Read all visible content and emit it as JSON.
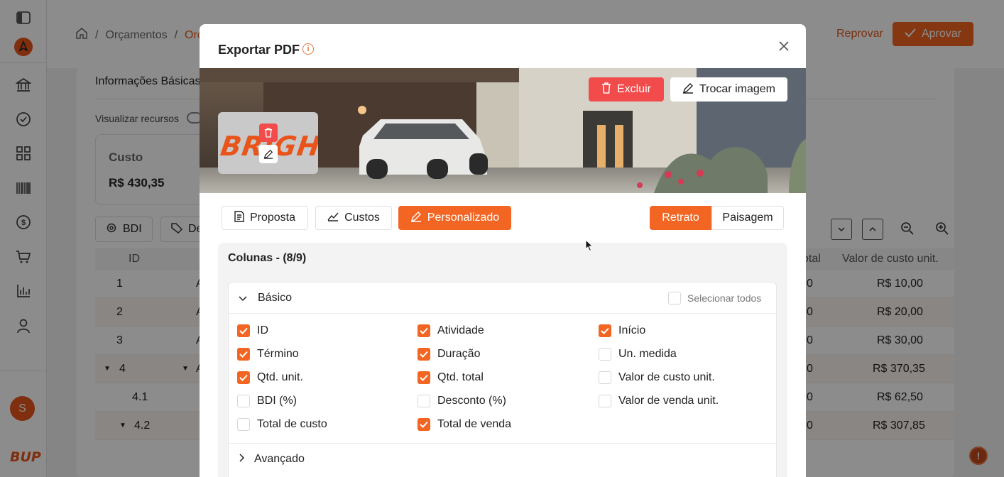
{
  "breadcrumb": {
    "items": [
      "Orçamentos",
      "Orça"
    ]
  },
  "header": {
    "reprovar_label": "Reprovar",
    "aprovar_label": "Aprovar"
  },
  "background": {
    "section_title": "Informações Básicas",
    "toggle_label": "Visualizar recursos",
    "card": {
      "label": "Custo",
      "value": "R$ 430,35"
    },
    "toolbar": {
      "bdi_label": "BDI",
      "desconto_label": "De"
    },
    "table": {
      "headers": {
        "id": "ID",
        "total": "otal",
        "unit_cost": "Valor de custo unit."
      },
      "rows": [
        {
          "id": "1",
          "act": "A",
          "total": "0",
          "unit": "R$ 10,00"
        },
        {
          "id": "2",
          "act": "A",
          "total": "0",
          "unit": "R$ 20,00"
        },
        {
          "id": "3",
          "act": "A",
          "total": "0",
          "unit": "R$ 30,00"
        },
        {
          "id": "4",
          "act": "A",
          "total": "0",
          "unit": "R$ 370,35"
        },
        {
          "id": "4.1",
          "act": "",
          "total": "0",
          "unit": "R$ 62,50"
        },
        {
          "id": "4.2",
          "act": "",
          "total": "0",
          "unit": "R$ 307,85"
        }
      ]
    }
  },
  "user": {
    "avatar_initial": "S"
  },
  "brand": {
    "short_logo": "BUP",
    "logo_text": "BRIGHUP"
  },
  "modal": {
    "title": "Exportar PDF",
    "banner": {
      "excluir_label": "Excluir",
      "trocar_label": "Trocar imagem"
    },
    "tabs": {
      "proposta": "Proposta",
      "custos": "Custos",
      "personalizado": "Personalizado"
    },
    "orientation": {
      "retrato": "Retrato",
      "paisagem": "Paisagem"
    },
    "columns_title": "Colunas - (8/9)",
    "basic_title": "Básico",
    "select_all_label": "Selecionar todos",
    "options": [
      {
        "label": "ID",
        "checked": true
      },
      {
        "label": "Atividade",
        "checked": true
      },
      {
        "label": "Início",
        "checked": true
      },
      {
        "label": "Término",
        "checked": true
      },
      {
        "label": "Duração",
        "checked": true
      },
      {
        "label": "Un. medida",
        "checked": false
      },
      {
        "label": "Qtd. unit.",
        "checked": true
      },
      {
        "label": "Qtd. total",
        "checked": true
      },
      {
        "label": "Valor de custo unit.",
        "checked": false
      },
      {
        "label": "BDI (%)",
        "checked": false
      },
      {
        "label": "Desconto (%)",
        "checked": false
      },
      {
        "label": "Valor de venda unit.",
        "checked": false
      },
      {
        "label": "Total de custo",
        "checked": false
      },
      {
        "label": "Total de venda",
        "checked": true
      }
    ],
    "advanced_title": "Avançado"
  },
  "colors": {
    "accent": "#f26522",
    "danger": "#f24b4b"
  }
}
